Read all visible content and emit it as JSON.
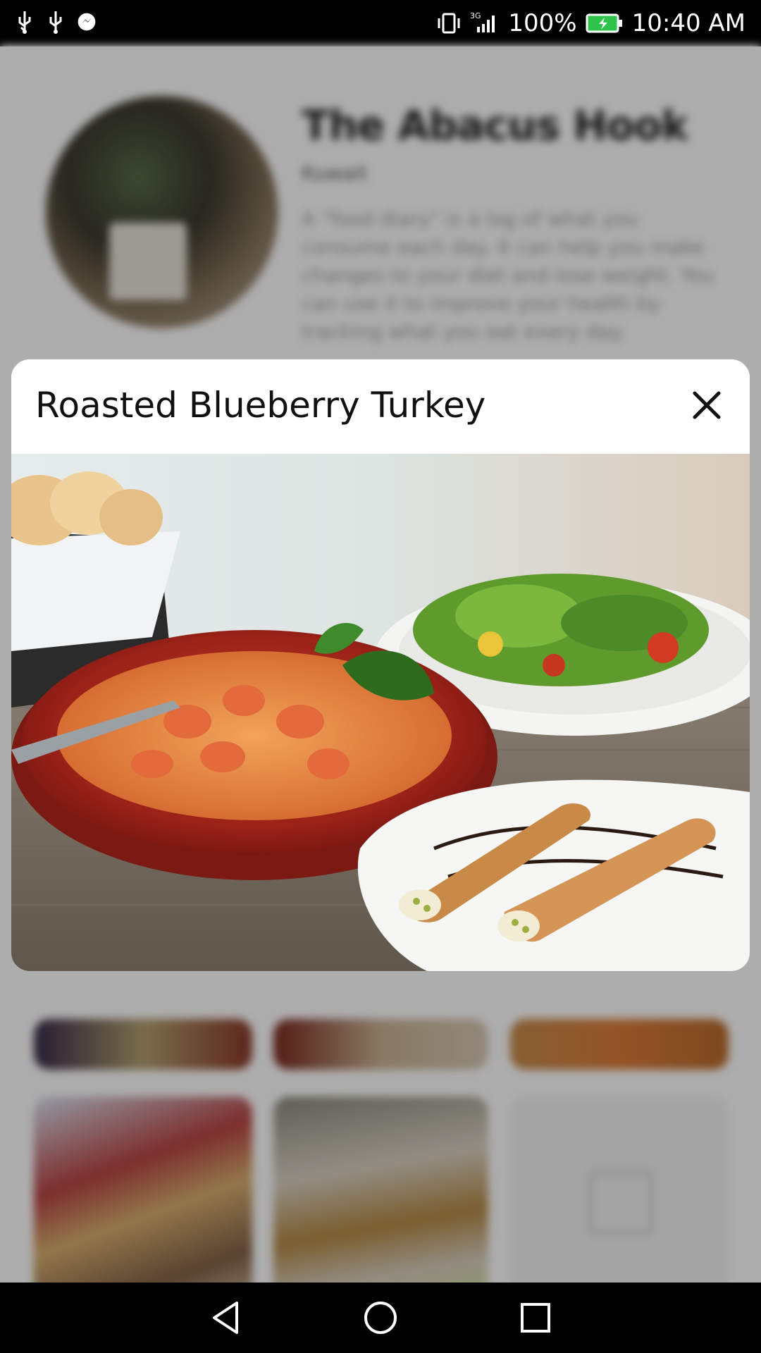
{
  "status_bar": {
    "battery_percent": "100%",
    "time": "10:40 AM",
    "network": "3G",
    "icons": [
      "usb-icon",
      "usb-icon",
      "messenger-icon",
      "vibrate-icon",
      "signal-icon",
      "battery-charging-icon"
    ]
  },
  "background_page": {
    "restaurant_name": "The Abacus Hook",
    "location": "Kuwait",
    "description": "A \"food diary\" is a log of what you consume each day. It can help you make changes to your diet and lose weight. You can use it to improve your health by tracking what you eat every day."
  },
  "dialog": {
    "title": "Roasted Blueberry Turkey",
    "close_icon": "close-icon",
    "image_alt": "food photo: shrimp pasta, salad, cannoli"
  },
  "nav_bar": {
    "icons": [
      "back-icon",
      "home-icon",
      "recents-icon"
    ]
  },
  "colors": {
    "status_bar_bg": "#000000",
    "dialog_bg": "#ffffff",
    "dim_overlay": "rgba(0,0,0,0.32)"
  }
}
